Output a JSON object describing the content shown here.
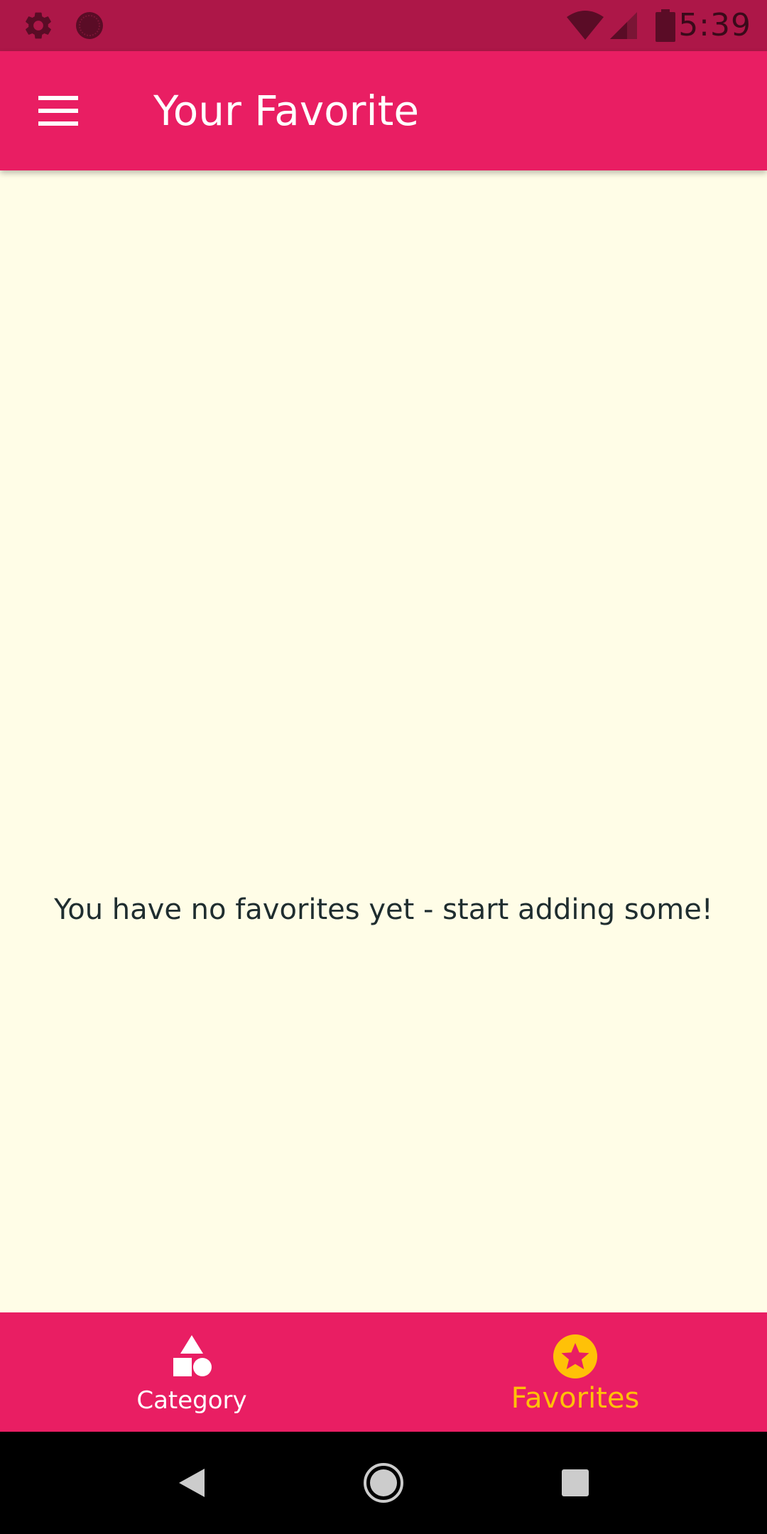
{
  "status_bar": {
    "time": "5:39",
    "icons": [
      "settings-icon",
      "record-icon",
      "wifi-icon",
      "signal-icon",
      "battery-icon"
    ]
  },
  "app_bar": {
    "title": "Your Favorite",
    "menu_icon": "hamburger-menu-icon"
  },
  "content": {
    "empty_message": "You have no favorites yet - start adding some!"
  },
  "bottom_nav": {
    "tabs": [
      {
        "label": "Category",
        "icon": "category-shapes-icon",
        "selected": false
      },
      {
        "label": "Favorites",
        "icon": "star-icon",
        "selected": true
      }
    ]
  },
  "system_nav": {
    "buttons": [
      "back-icon",
      "home-icon",
      "recents-icon"
    ]
  },
  "colors": {
    "status_bar": "#AD1748",
    "primary": "#E91E63",
    "background": "#FFFDE7",
    "accent": "#FFC107",
    "text": "#1F2D2F"
  }
}
